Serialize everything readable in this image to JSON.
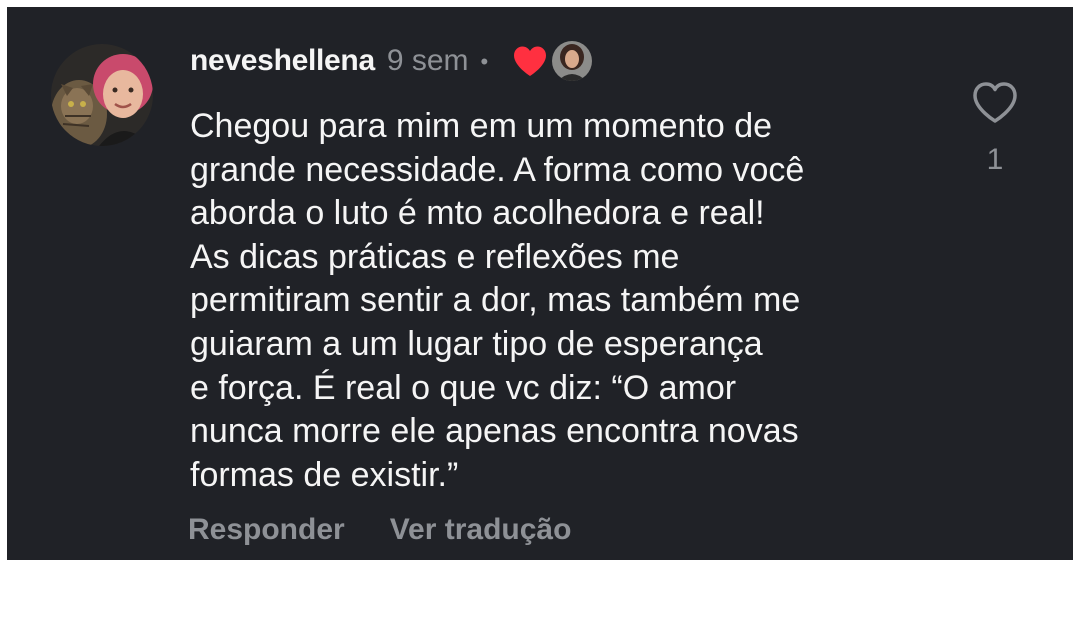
{
  "comment": {
    "username": "neveshellena",
    "time": "9 sem",
    "separator": "•",
    "text": "Chegou para mim em um momento de\ngrande necessidade. A forma como você\naborda o luto é mto acolhedora e real!\nAs dicas práticas e reflexões me\npermitiram sentir a dor, mas também me\nguiaram a um lugar tipo de esperança\ne força. É real o que vc diz: “O amor\nnunca morre ele apenas encontra novas\nformas de existir.”",
    "liked_by_author": true,
    "like_count": "1",
    "actions": {
      "reply_label": "Responder",
      "translate_label": "Ver tradução"
    }
  },
  "icons": {
    "avatar": "user-avatar",
    "liked": "red-heart-icon",
    "liked_by": "author-avatar",
    "like": "heart-outline-icon"
  },
  "colors": {
    "background": "#202227",
    "text": "#f5f5f5",
    "muted": "#8e9196",
    "heart": "#ff3040"
  }
}
